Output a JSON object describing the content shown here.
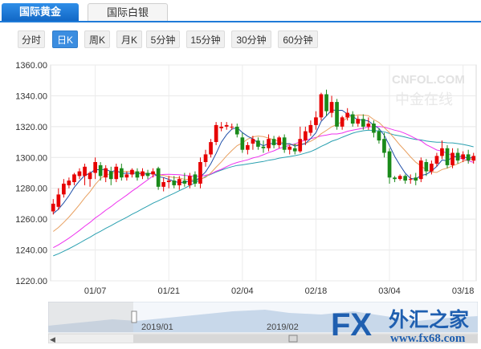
{
  "tabs": [
    {
      "label": "国际黄金",
      "active": true
    },
    {
      "label": "国际白银",
      "active": false
    }
  ],
  "periods": [
    {
      "label": "分时",
      "active": false
    },
    {
      "label": "日K",
      "active": true
    },
    {
      "label": "周K",
      "active": false
    },
    {
      "label": "月K",
      "active": false
    },
    {
      "label": "5分钟",
      "active": false
    },
    {
      "label": "15分钟",
      "active": false
    },
    {
      "label": "30分钟",
      "active": false
    },
    {
      "label": "60分钟",
      "active": false
    }
  ],
  "watermark": "CNFOL.COM",
  "watermark_cn": "中金在线",
  "navigator": {
    "labels": [
      "2019/01",
      "2019/02"
    ]
  },
  "logo": {
    "fx": "FX",
    "cn": "外汇之家",
    "url": "www.fx68.com"
  },
  "colors": {
    "up": "#e60000",
    "down": "#1a8a1a",
    "ma5": "#1f4fa8",
    "ma10": "#e8a060",
    "ma20": "#ee33ee",
    "ma30": "#2aa0b0",
    "accent": "#1f7bd8"
  },
  "chart_data": {
    "type": "candlestick",
    "ylim": [
      1220,
      1360
    ],
    "yticks": [
      1220,
      1240,
      1260,
      1280,
      1300,
      1320,
      1340,
      1360
    ],
    "ytick_labels": [
      "1220.00",
      "1240.00",
      "1260.00",
      "1280.00",
      "1300.00",
      "1320.00",
      "1340.00",
      "1360.00"
    ],
    "xtick_labels": [
      "01/07",
      "01/21",
      "02/04",
      "02/18",
      "03/04",
      "03/18"
    ],
    "xtick_index": [
      8,
      22,
      36,
      50,
      64,
      78
    ],
    "candles": [
      [
        1265,
        1270,
        1263,
        1273
      ],
      [
        1268,
        1276,
        1266,
        1280
      ],
      [
        1276,
        1283,
        1274,
        1286
      ],
      [
        1282,
        1285,
        1280,
        1287
      ],
      [
        1284,
        1289,
        1282,
        1290
      ],
      [
        1288,
        1291,
        1286,
        1293
      ],
      [
        1288,
        1294,
        1282,
        1296
      ],
      [
        1286,
        1290,
        1281,
        1291
      ],
      [
        1290,
        1297,
        1286,
        1300
      ],
      [
        1295,
        1288,
        1285,
        1297
      ],
      [
        1287,
        1293,
        1284,
        1295
      ],
      [
        1291,
        1286,
        1282,
        1294
      ],
      [
        1286,
        1294,
        1284,
        1296
      ],
      [
        1293,
        1287,
        1285,
        1296
      ],
      [
        1287,
        1289,
        1285,
        1291
      ],
      [
        1289,
        1292,
        1287,
        1293
      ],
      [
        1291,
        1287,
        1285,
        1293
      ],
      [
        1288,
        1291,
        1286,
        1293
      ],
      [
        1290,
        1288,
        1286,
        1292
      ],
      [
        1289,
        1291,
        1287,
        1293
      ],
      [
        1293,
        1281,
        1279,
        1294
      ],
      [
        1281,
        1284,
        1278,
        1287
      ],
      [
        1284,
        1285,
        1280,
        1288
      ],
      [
        1285,
        1282,
        1280,
        1288
      ],
      [
        1282,
        1286,
        1279,
        1288
      ],
      [
        1285,
        1283,
        1281,
        1290
      ],
      [
        1282,
        1288,
        1280,
        1290
      ],
      [
        1289,
        1283,
        1281,
        1291
      ],
      [
        1283,
        1297,
        1280,
        1300
      ],
      [
        1297,
        1302,
        1294,
        1305
      ],
      [
        1302,
        1310,
        1300,
        1312
      ],
      [
        1310,
        1321,
        1308,
        1323
      ],
      [
        1319,
        1320,
        1317,
        1323
      ],
      [
        1320,
        1321,
        1318,
        1323
      ],
      [
        1320,
        1320,
        1318,
        1322
      ],
      [
        1320,
        1315,
        1313,
        1322
      ],
      [
        1313,
        1305,
        1303,
        1316
      ],
      [
        1305,
        1308,
        1302,
        1310
      ],
      [
        1309,
        1312,
        1305,
        1314
      ],
      [
        1311,
        1307,
        1305,
        1313
      ],
      [
        1307,
        1306,
        1303,
        1311
      ],
      [
        1306,
        1312,
        1304,
        1315
      ],
      [
        1312,
        1308,
        1306,
        1314
      ],
      [
        1308,
        1313,
        1306,
        1314
      ],
      [
        1313,
        1305,
        1303,
        1315
      ],
      [
        1305,
        1307,
        1302,
        1308
      ],
      [
        1306,
        1304,
        1302,
        1309
      ],
      [
        1304,
        1312,
        1303,
        1320
      ],
      [
        1311,
        1317,
        1308,
        1320
      ],
      [
        1316,
        1321,
        1314,
        1324
      ],
      [
        1321,
        1326,
        1318,
        1330
      ],
      [
        1326,
        1341,
        1324,
        1342
      ],
      [
        1341,
        1330,
        1327,
        1344
      ],
      [
        1329,
        1336,
        1326,
        1340
      ],
      [
        1336,
        1320,
        1318,
        1338
      ],
      [
        1320,
        1326,
        1318,
        1327
      ],
      [
        1326,
        1329,
        1324,
        1332
      ],
      [
        1328,
        1322,
        1320,
        1330
      ],
      [
        1322,
        1325,
        1320,
        1327
      ],
      [
        1325,
        1320,
        1318,
        1328
      ],
      [
        1320,
        1322,
        1318,
        1326
      ],
      [
        1322,
        1316,
        1313,
        1324
      ],
      [
        1317,
        1311,
        1309,
        1319
      ],
      [
        1312,
        1303,
        1300,
        1316
      ],
      [
        1304,
        1287,
        1283,
        1306
      ],
      [
        1287,
        1286,
        1284,
        1288
      ],
      [
        1286,
        1288,
        1285,
        1289
      ],
      [
        1288,
        1285,
        1283,
        1289
      ],
      [
        1286,
        1286,
        1283,
        1289
      ],
      [
        1287,
        1285,
        1282,
        1290
      ],
      [
        1286,
        1298,
        1284,
        1300
      ],
      [
        1297,
        1291,
        1288,
        1299
      ],
      [
        1291,
        1296,
        1289,
        1298
      ],
      [
        1296,
        1301,
        1294,
        1303
      ],
      [
        1301,
        1306,
        1299,
        1311
      ],
      [
        1306,
        1295,
        1293,
        1308
      ],
      [
        1295,
        1303,
        1293,
        1306
      ],
      [
        1303,
        1298,
        1296,
        1306
      ],
      [
        1299,
        1302,
        1297,
        1304
      ],
      [
        1302,
        1298,
        1296,
        1305
      ],
      [
        1298,
        1301,
        1296,
        1303
      ]
    ]
  }
}
